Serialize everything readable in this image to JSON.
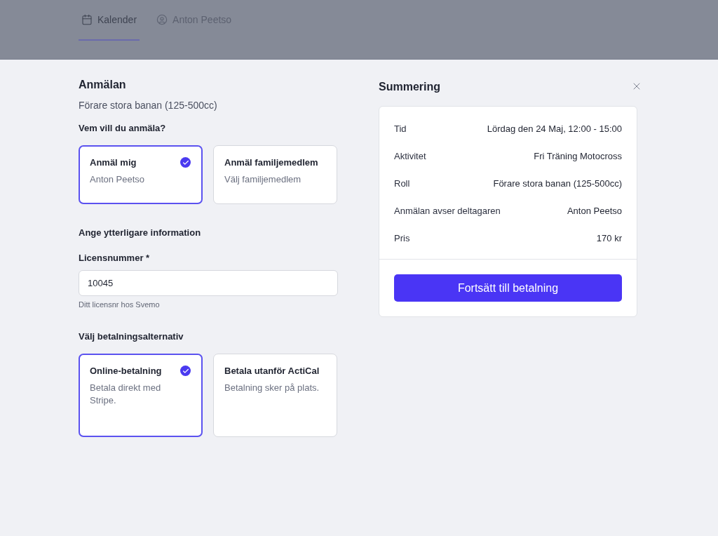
{
  "tabs": [
    {
      "label": "Kalender",
      "selected": true
    },
    {
      "label": "Anton Peetso",
      "selected": false
    }
  ],
  "form": {
    "title": "Anmälan",
    "subtitle": "Förare stora banan (125-500cc)",
    "who_heading": "Vem vill du anmäla?",
    "who_options": [
      {
        "title": "Anmäl mig",
        "description": "Anton Peetso",
        "selected": true
      },
      {
        "title": "Anmäl familjemedlem",
        "description": "Välj familjemedlem",
        "selected": false
      }
    ],
    "info_heading": "Ange ytterligare information",
    "license_field": {
      "label": "Licensnummer *",
      "value": "10045",
      "hint": "Ditt licensnr hos Svemo"
    },
    "payment_heading": "Välj betalningsalternativ",
    "payment_options": [
      {
        "title": "Online-betalning",
        "description": "Betala direkt med Stripe.",
        "selected": true
      },
      {
        "title": "Betala utanför ActiCal",
        "description": "Betalning sker på plats.",
        "selected": false
      }
    ]
  },
  "summary": {
    "title": "Summering",
    "rows": [
      {
        "label": "Tid",
        "value": "Lördag den 24 Maj, 12:00 - 15:00"
      },
      {
        "label": "Aktivitet",
        "value": "Fri Träning Motocross"
      },
      {
        "label": "Roll",
        "value": "Förare stora banan (125-500cc)"
      },
      {
        "label": "Anmälan avser deltagaren",
        "value": "Anton Peetso"
      },
      {
        "label": "Pris",
        "value": "170 kr"
      }
    ],
    "button": "Fortsätt till betalning"
  }
}
